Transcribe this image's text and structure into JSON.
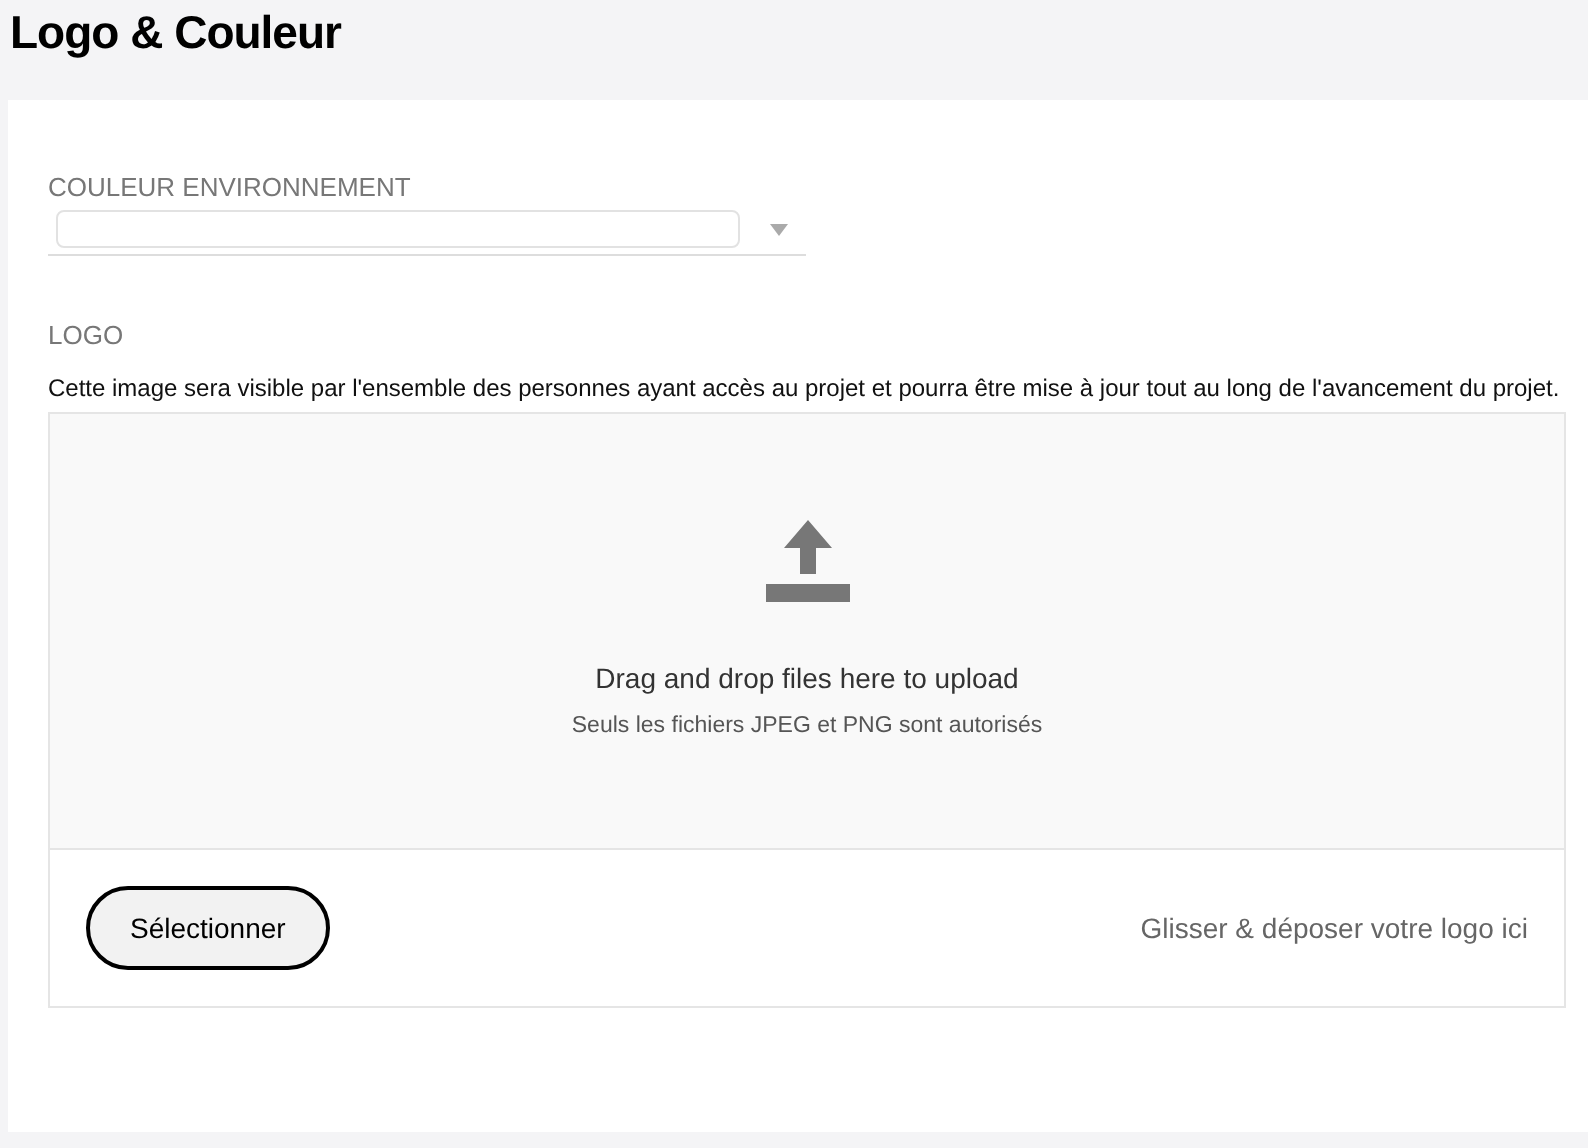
{
  "page_title": "Logo & Couleur",
  "color_field": {
    "label": "COULEUR ENVIRONNEMENT"
  },
  "logo": {
    "label": "LOGO",
    "description": "Cette image sera visible par l'ensemble des personnes ayant accès au projet et pourra être mise à jour tout au long de l'avancement du projet."
  },
  "dropzone": {
    "title": "Drag and drop files here to upload",
    "hint": "Seuls les fichiers JPEG et PNG sont autorisés",
    "button": "Sélectionner",
    "footer_text": "Glisser & déposer votre logo ici"
  }
}
